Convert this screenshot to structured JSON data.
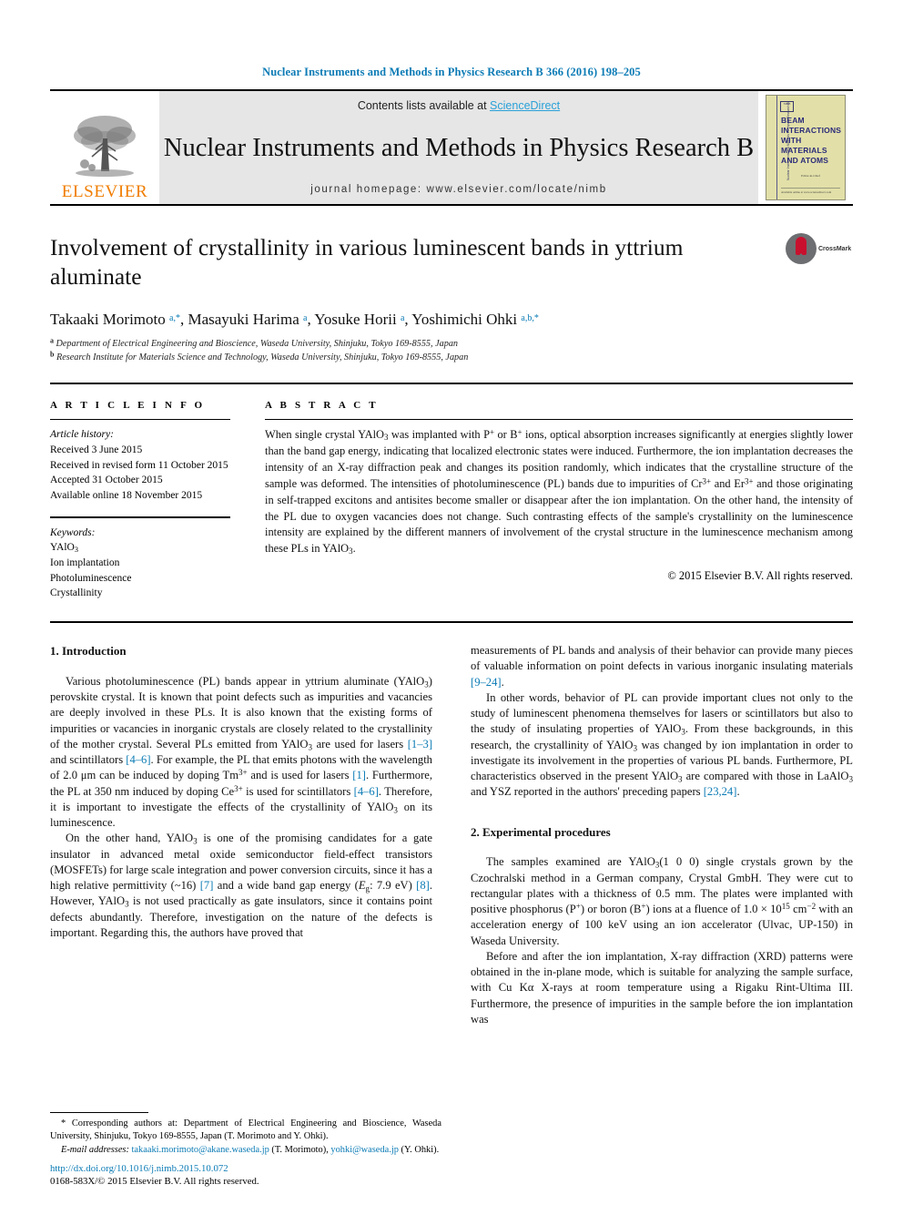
{
  "running_head": "Nuclear Instruments and Methods in Physics Research B 366 (2016) 198–205",
  "masthead": {
    "contents_prefix": "Contents lists available at ",
    "sciencedirect": "ScienceDirect",
    "journal_title": "Nuclear Instruments and Methods in Physics Research B",
    "homepage": "journal homepage: www.elsevier.com/locate/nimb",
    "publisher_name": "ELSEVIER",
    "cover": {
      "title_lines": [
        "BEAM",
        "INTERACTIONS",
        "WITH",
        "MATERIALS",
        "AND ATOMS"
      ],
      "spine_text": "Nuclear Instruments and Methods in Physics Research B",
      "badge_text": "NIMB",
      "editor_line": "Editor-in-Chief",
      "bottom_line": "Available online at www.sciencedirect.com"
    }
  },
  "article": {
    "title": "Involvement of crystallinity in various luminescent bands in yttrium aluminate",
    "crossmark_label": "CrossMark",
    "authors_html": "Takaaki Morimoto <sup>a,*</sup>, Masayuki Harima <sup>a</sup>, Yosuke Horii <sup>a</sup>, Yoshimichi Ohki <sup>a,b,</sup><sup>*</sup>",
    "affiliation_a": "Department of Electrical Engineering and Bioscience, Waseda University, Shinjuku, Tokyo 169-8555, Japan",
    "affiliation_b": "Research Institute for Materials Science and Technology, Waseda University, Shinjuku, Tokyo 169-8555, Japan"
  },
  "article_info": {
    "heading": "A R T I C L E   I N F O",
    "history_label": "Article history:",
    "history": [
      "Received 3 June 2015",
      "Received in revised form 11 October 2015",
      "Accepted 31 October 2015",
      "Available online 18 November 2015"
    ],
    "keywords_label": "Keywords:",
    "keywords_html": [
      "YAlO<sub>3</sub>",
      "Ion implantation",
      "Photoluminescence",
      "Crystallinity"
    ]
  },
  "abstract": {
    "heading": "A B S T R A C T",
    "text_html": "When single crystal YAlO<sub>3</sub> was implanted with P<sup>+</sup> or B<sup>+</sup> ions, optical absorption increases significantly at energies slightly lower than the band gap energy, indicating that localized electronic states were induced. Furthermore, the ion implantation decreases the intensity of an X-ray diffraction peak and changes its position randomly, which indicates that the crystalline structure of the sample was deformed. The intensities of photoluminescence (PL) bands due to impurities of Cr<sup>3+</sup> and Er<sup>3+</sup> and those originating in self-trapped excitons and antisites become smaller or disappear after the ion implantation. On the other hand, the intensity of the PL due to oxygen vacancies does not change. Such contrasting effects of the sample's crystallinity on the luminescence intensity are explained by the different manners of involvement of the crystal structure in the luminescence mechanism among these PLs in YAlO<sub>3</sub>.",
    "copyright": "© 2015 Elsevier B.V. All rights reserved."
  },
  "body": {
    "section1_title": "1. Introduction",
    "section1_p1_html": "Various photoluminescence (PL) bands appear in yttrium aluminate (YAlO<sub>3</sub>) perovskite crystal. It is known that point defects such as impurities and vacancies are deeply involved in these PLs. It is also known that the existing forms of impurities or vacancies in inorganic crystals are closely related to the crystallinity of the mother crystal. Several PLs emitted from YAlO<sub>3</sub> are used for lasers <span class=\"ref\">[1–3]</span> and scintillators <span class=\"ref\">[4–6]</span>. For example, the PL that emits photons with the wavelength of 2.0 μm can be induced by doping Tm<sup>3+</sup> and is used for lasers <span class=\"ref\">[1]</span>. Furthermore, the PL at 350 nm induced by doping Ce<sup>3+</sup> is used for scintillators <span class=\"ref\">[4–6]</span>. Therefore, it is important to investigate the effects of the crystallinity of YAlO<sub>3</sub> on its luminescence.",
    "section1_p2_html": "On the other hand, YAlO<sub>3</sub> is one of the promising candidates for a gate insulator in advanced metal oxide semiconductor field-effect transistors (MOSFETs) for large scale integration and power conversion circuits, since it has a high relative permittivity (~16) <span class=\"ref\">[7]</span> and a wide band gap energy (<i>E</i><sub>g</sub>: 7.9 eV) <span class=\"ref\">[8]</span>. However, YAlO<sub>3</sub> is not used practically as gate insulators, since it contains point defects abundantly. Therefore, investigation on the nature of the defects is important. Regarding this, the authors have proved that",
    "section1_p3_html": "measurements of PL bands and analysis of their behavior can provide many pieces of valuable information on point defects in various inorganic insulating materials <span class=\"ref\">[9–24]</span>.",
    "section1_p4_html": "In other words, behavior of PL can provide important clues not only to the study of luminescent phenomena themselves for lasers or scintillators but also to the study of insulating properties of YAlO<sub>3</sub>. From these backgrounds, in this research, the crystallinity of YAlO<sub>3</sub> was changed by ion implantation in order to investigate its involvement in the properties of various PL bands. Furthermore, PL characteristics observed in the present YAlO<sub>3</sub> are compared with those in LaAlO<sub>3</sub> and YSZ reported in the authors' preceding papers <span class=\"ref\">[23,24]</span>.",
    "section2_title": "2. Experimental procedures",
    "section2_p1_html": "The samples examined are YAlO<sub>3</sub>(1 0 0) single crystals grown by the Czochralski method in a German company, Crystal GmbH. They were cut to rectangular plates with a thickness of 0.5 mm. The plates were implanted with positive phosphorus (P<sup>+</sup>) or boron (B<sup>+</sup>) ions at a fluence of 1.0 × 10<sup>15</sup> cm<sup>−2</sup> with an acceleration energy of 100 keV using an ion accelerator (Ulvac, UP-150) in Waseda University.",
    "section2_p2_html": "Before and after the ion implantation, X-ray diffraction (XRD) patterns were obtained in the in-plane mode, which is suitable for analyzing the sample surface, with Cu Kα X-rays at room temperature using a Rigaku Rint-Ultima III. Furthermore, the presence of impurities in the sample before the ion implantation was"
  },
  "footnotes": {
    "corresponding_html": "* Corresponding authors at: Department of Electrical Engineering and Bioscience, Waseda University, Shinjuku, Tokyo 169-8555, Japan (T. Morimoto and Y. Ohki).",
    "email_html": "<i>E-mail addresses:</i> <span class=\"lnk\">takaaki.morimoto@akane.waseda.jp</span> (T. Morimoto), <span class=\"lnk\">yohki@waseda.jp</span> (Y. Ohki)."
  },
  "doi": {
    "url": "http://dx.doi.org/10.1016/j.nimb.2015.10.072",
    "issn_line": "0168-583X/© 2015 Elsevier B.V. All rights reserved."
  },
  "colors": {
    "link_blue": "#0b7bb5",
    "sciencedirect_blue": "#2aa1d8",
    "elsevier_orange": "#f07d00",
    "cover_yellow": "#e2e0a8",
    "cover_blue": "#2a2a7a"
  }
}
